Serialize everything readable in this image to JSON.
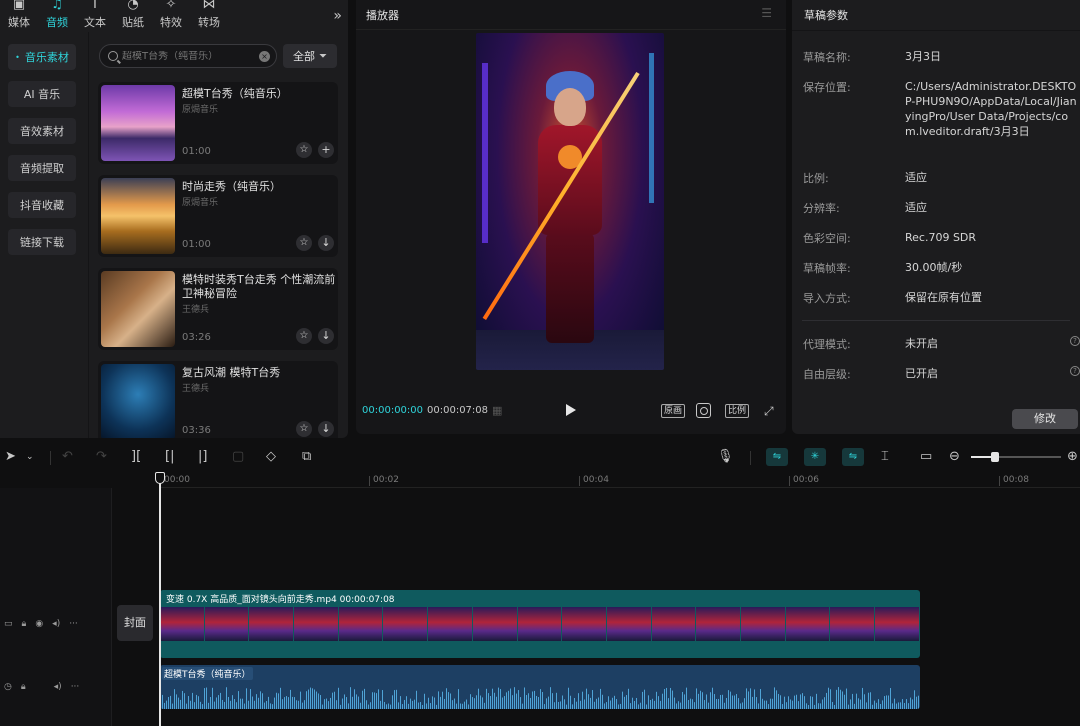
{
  "media_tabs": [
    {
      "label": "媒体",
      "icon": "media-icon"
    },
    {
      "label": "音频",
      "icon": "music-note-icon"
    },
    {
      "label": "文本",
      "icon": "text-icon"
    },
    {
      "label": "贴纸",
      "icon": "sticker-icon"
    },
    {
      "label": "特效",
      "icon": "effects-icon"
    },
    {
      "label": "转场",
      "icon": "transition-icon"
    }
  ],
  "categories": [
    "音乐素材",
    "AI 音乐",
    "音效素材",
    "音频提取",
    "抖音收藏",
    "链接下载"
  ],
  "search": {
    "placeholder": "超模T台秀（纯音乐）"
  },
  "filter": {
    "label": "全部"
  },
  "tracks": [
    {
      "name": "超模T台秀（纯音乐）",
      "artist": "原焗音乐",
      "duration": "01:00",
      "action": "add"
    },
    {
      "name": "时尚走秀（纯音乐）",
      "artist": "原焗音乐",
      "duration": "01:00",
      "action": "download"
    },
    {
      "name": "模特时装秀T台走秀 个性潮流前卫神秘冒险",
      "artist": "王德兵",
      "duration": "03:26",
      "action": "download"
    },
    {
      "name": "复古风潮 模特T台秀",
      "artist": "王德兵",
      "duration": "03:36",
      "action": "download"
    }
  ],
  "player": {
    "title": "播放器",
    "current_time": "00:00:00:00",
    "total_time": "00:00:07:08",
    "btn_original": "原画",
    "btn_ratio": "比例"
  },
  "props": {
    "title": "草稿参数",
    "rows": [
      {
        "key": "草稿名称:",
        "value": "3月3日"
      },
      {
        "key": "保存位置:",
        "value": "C:/Users/Administrator.DESKTOP-PHU9N9O/AppData/Local/JianyingPro/User Data/Projects/com.lveditor.draft/3月3日"
      },
      {
        "key": "比例:",
        "value": "适应"
      },
      {
        "key": "分辨率:",
        "value": "适应"
      },
      {
        "key": "色彩空间:",
        "value": "Rec.709 SDR"
      },
      {
        "key": "草稿帧率:",
        "value": "30.00帧/秒"
      },
      {
        "key": "导入方式:",
        "value": "保留在原有位置"
      },
      {
        "key": "代理模式:",
        "value": "未开启"
      },
      {
        "key": "自由层级:",
        "value": "已开启"
      }
    ],
    "modify": "修改"
  },
  "timeline": {
    "ruler": [
      "00:00",
      "00:02",
      "00:04",
      "00:06",
      "00:08"
    ],
    "cover": "封面",
    "video_clip": "变速 0.7X  高品质_面对镜头向前走秀.mp4  00:00:07:08",
    "audio_clip": "超模T台秀（纯音乐）",
    "zoom_level": 0.27
  },
  "colors": {
    "accent": "#2fd3d9",
    "video_clip": "#0f5a5e",
    "audio_clip": "#1d3f63",
    "waveform": "#4fa3d6"
  }
}
